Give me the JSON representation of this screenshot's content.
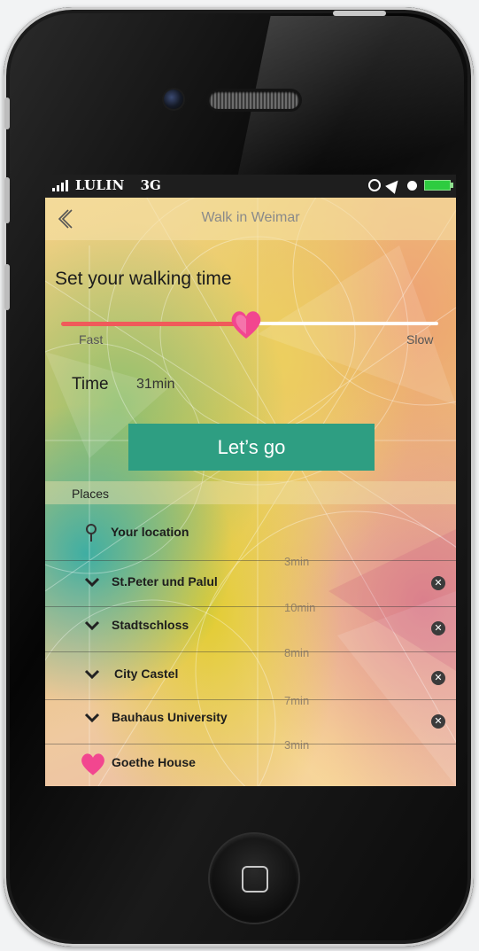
{
  "status_bar": {
    "carrier": "LULIN",
    "network": "3G",
    "icons": [
      "signal-icon",
      "rotation-lock-icon",
      "location-arrow-icon",
      "alarm-icon",
      "battery-icon"
    ],
    "battery_color": "#2ecc40"
  },
  "nav": {
    "back_icon": "chevron-left-icon",
    "title": "Walk in Weimar"
  },
  "walking_time": {
    "heading": "Set your walking time",
    "slider_min_label": "Fast",
    "slider_max_label": "Slow",
    "slider_value_fraction": 0.5,
    "thumb_icon": "heart-icon",
    "time_label": "Time",
    "time_value": "31min"
  },
  "go_button": {
    "label": "Let’s go",
    "color": "#2e9e82"
  },
  "places": {
    "label": "Places",
    "start": {
      "name": "Your location",
      "icon": "map-pin-icon"
    },
    "stops": [
      {
        "duration": "3min",
        "name": "St.Peter und Palul"
      },
      {
        "duration": "10min",
        "name": "Stadtschloss"
      },
      {
        "duration": "8min",
        "name": "City Castel"
      },
      {
        "duration": "7min",
        "name": "Bauhaus University"
      }
    ],
    "end": {
      "duration": "3min",
      "name": "Goethe House",
      "icon": "heart-icon"
    },
    "row_icon": "chevron-down-icon",
    "remove_icon": "remove-circle-icon"
  }
}
